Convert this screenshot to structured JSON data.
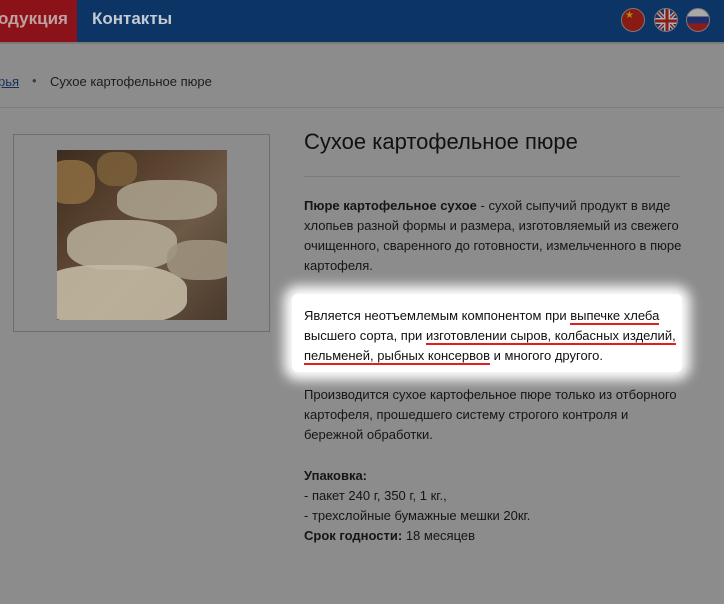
{
  "nav": {
    "products_label": "одукция",
    "contacts_label": "Контакты",
    "flags": [
      "china-flag",
      "uk-flag",
      "russia-flag"
    ]
  },
  "breadcrumb": {
    "parent_label": "рья",
    "separator": "•",
    "current_label": "Сухое картофельное пюре"
  },
  "product": {
    "title": "Сухое картофельное пюре",
    "intro_bold": "Пюре картофельное сухое",
    "intro_rest": " - сухой сыпучий продукт в виде хлопьев разной формы и размера, изготовляемый из свежего очищенного, сваренного до готовности, измельченного в пюре картофеля.",
    "usage_1": "Является неотъемлемым компонентом при ",
    "usage_link_1": "выпечке хлеба",
    "usage_2": " высшего сорта, при ",
    "usage_link_2": "изготовлении сыров, колбасных изделий, пельменей, рыбных консервов",
    "usage_3": " и многого другого.",
    "production": "Производится сухое картофельное пюре только из отборного картофеля, прошедшего систему строгого контроля и бережной обработки.",
    "packaging_label": "Упаковка:",
    "packaging_line_1": "- пакет 240 г, 350 г, 1 кг.,",
    "packaging_line_2": "- трехслойные бумажные мешки 20кг.",
    "shelf_life_label": "Срок годности:",
    "shelf_life_value": " 18 месяцев"
  },
  "colors": {
    "nav_bg": "#0c3565",
    "nav_active": "#8b1218",
    "underline": "#e31c1c"
  }
}
